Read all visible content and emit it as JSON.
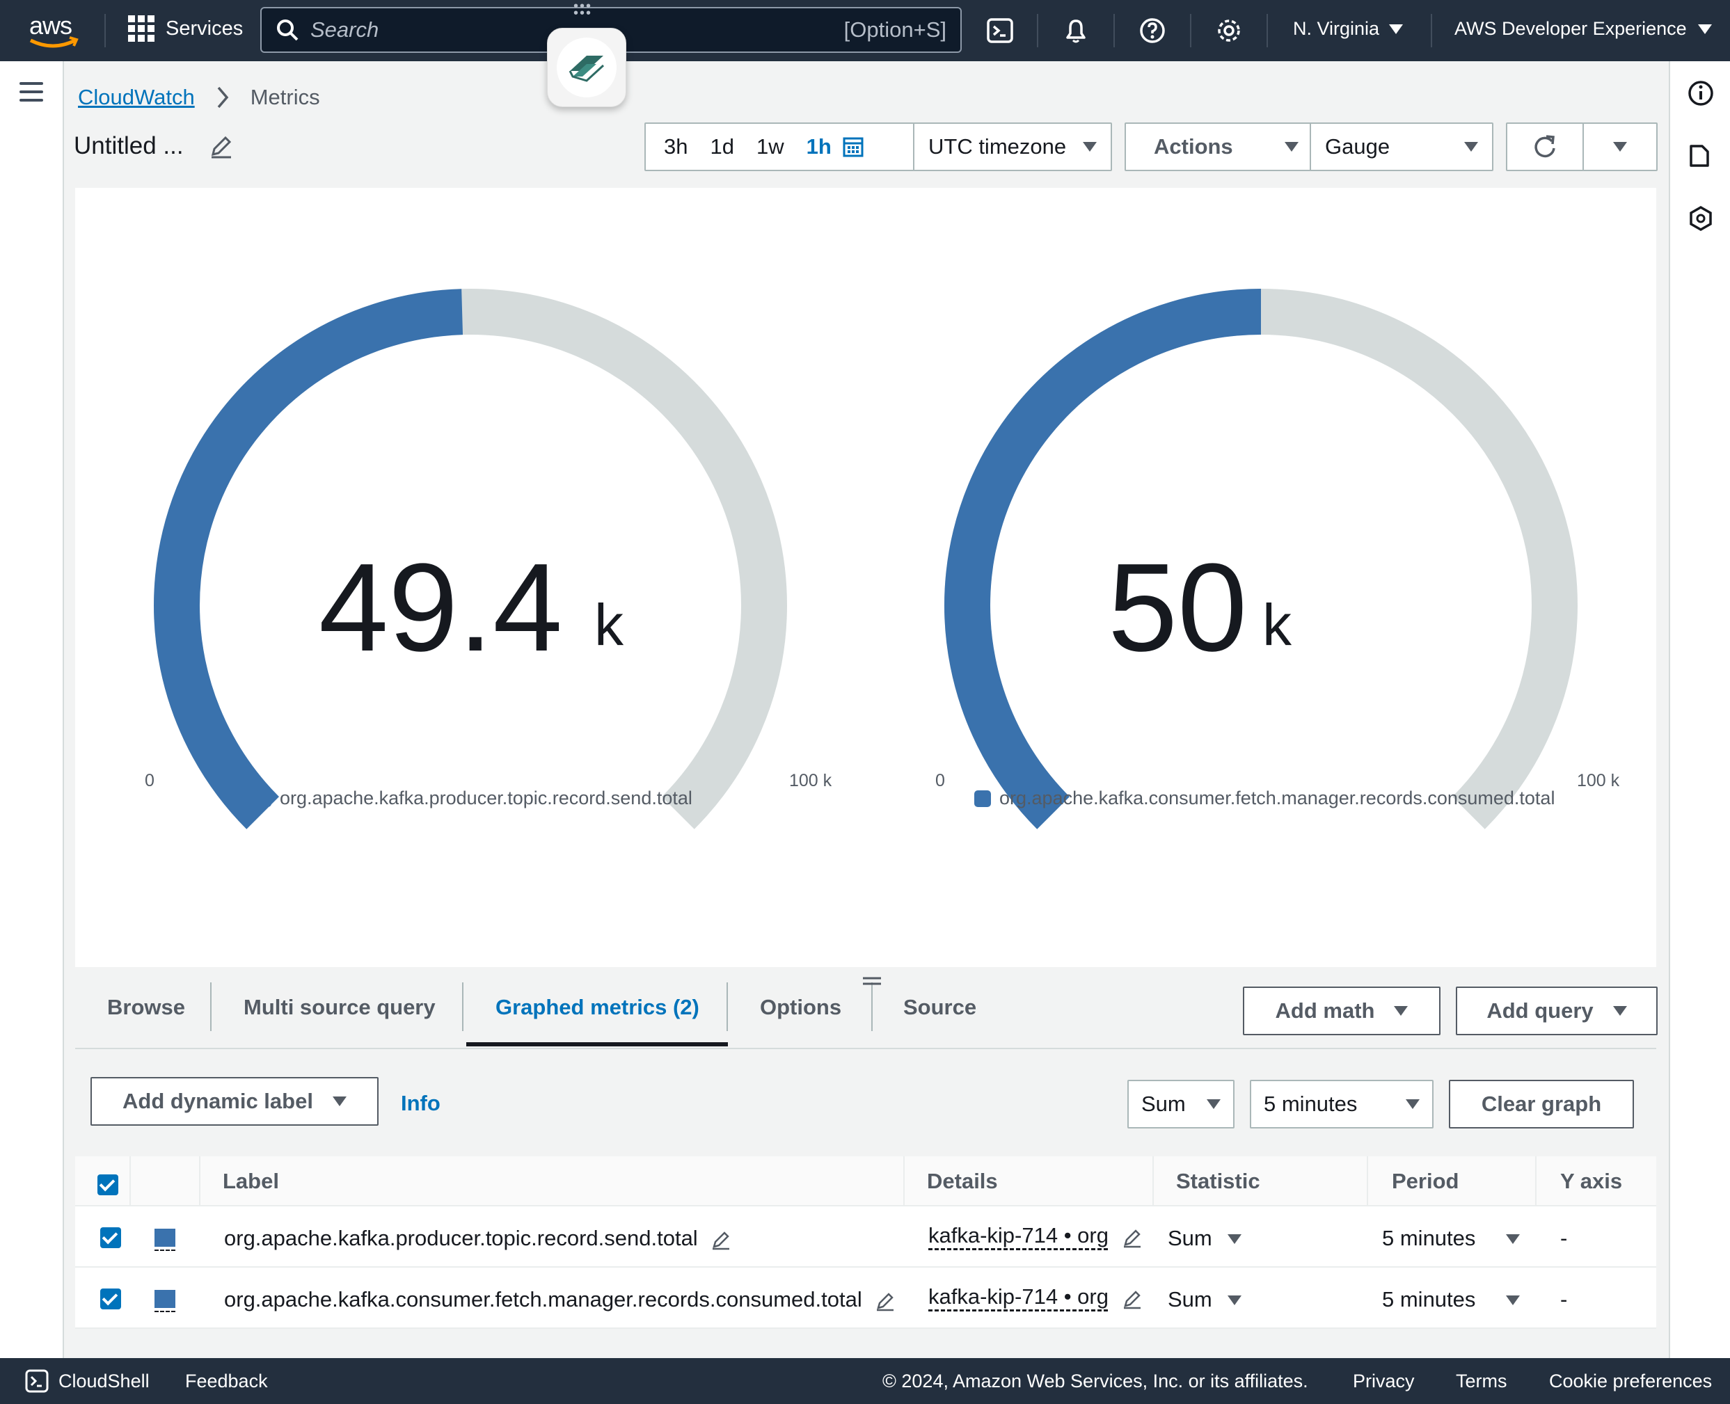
{
  "topnav": {
    "logo_text": "aws",
    "services_label": "Services",
    "search_placeholder": "Search",
    "search_shortcut": "[Option+S]",
    "region": "N. Virginia",
    "account": "AWS Developer Experience",
    "icons": [
      "cloudshell-icon",
      "bell-icon",
      "help-icon",
      "settings-icon"
    ]
  },
  "breadcrumb": {
    "root": "CloudWatch",
    "current": "Metrics"
  },
  "title": "Untitled ...",
  "toolbar": {
    "ranges": [
      "3h",
      "1d",
      "1w",
      "1h"
    ],
    "active_range": "1h",
    "timezone": "UTC timezone",
    "actions": "Actions",
    "view": "Gauge"
  },
  "gauges": [
    {
      "value": "49.4",
      "unit": "k",
      "value_num": 49400,
      "min": "0",
      "max": "100 k",
      "legend": "org.apache.kafka.producer.topic.record.send.total",
      "fill_fraction": 0.494
    },
    {
      "value": "50",
      "unit": "k",
      "value_num": 50000,
      "min": "0",
      "max": "100 k",
      "legend": "org.apache.kafka.consumer.fetch.manager.records.consumed.total",
      "fill_fraction": 0.5
    }
  ],
  "colors": {
    "accent": "#0073bb",
    "series": "#3a72ad",
    "gauge_track": "#d5dbdb",
    "nav_bg": "#232f3e"
  },
  "tabs": [
    "Browse",
    "Multi source query",
    "Graphed metrics (2)",
    "Options",
    "Source"
  ],
  "active_tab": "Graphed metrics (2)",
  "tab_actions": {
    "add_math": "Add math",
    "add_query": "Add query"
  },
  "controls": {
    "add_dynamic_label": "Add dynamic label",
    "info": "Info",
    "statistic": "Sum",
    "period": "5 minutes",
    "clear_graph": "Clear graph"
  },
  "table": {
    "headers": {
      "label": "Label",
      "details": "Details",
      "statistic": "Statistic",
      "period": "Period",
      "y_axis": "Y axis"
    },
    "rows": [
      {
        "label": "org.apache.kafka.producer.topic.record.send.total",
        "details": "kafka-kip-714 • org",
        "statistic": "Sum",
        "period": "5 minutes",
        "y_axis": "-"
      },
      {
        "label": "org.apache.kafka.consumer.fetch.manager.records.consumed.total",
        "details": "kafka-kip-714 • org",
        "statistic": "Sum",
        "period": "5 minutes",
        "y_axis": "-"
      }
    ]
  },
  "footer": {
    "cloudshell": "CloudShell",
    "feedback": "Feedback",
    "copyright": "© 2024, Amazon Web Services, Inc. or its affiliates.",
    "privacy": "Privacy",
    "terms": "Terms",
    "cookies": "Cookie preferences"
  }
}
